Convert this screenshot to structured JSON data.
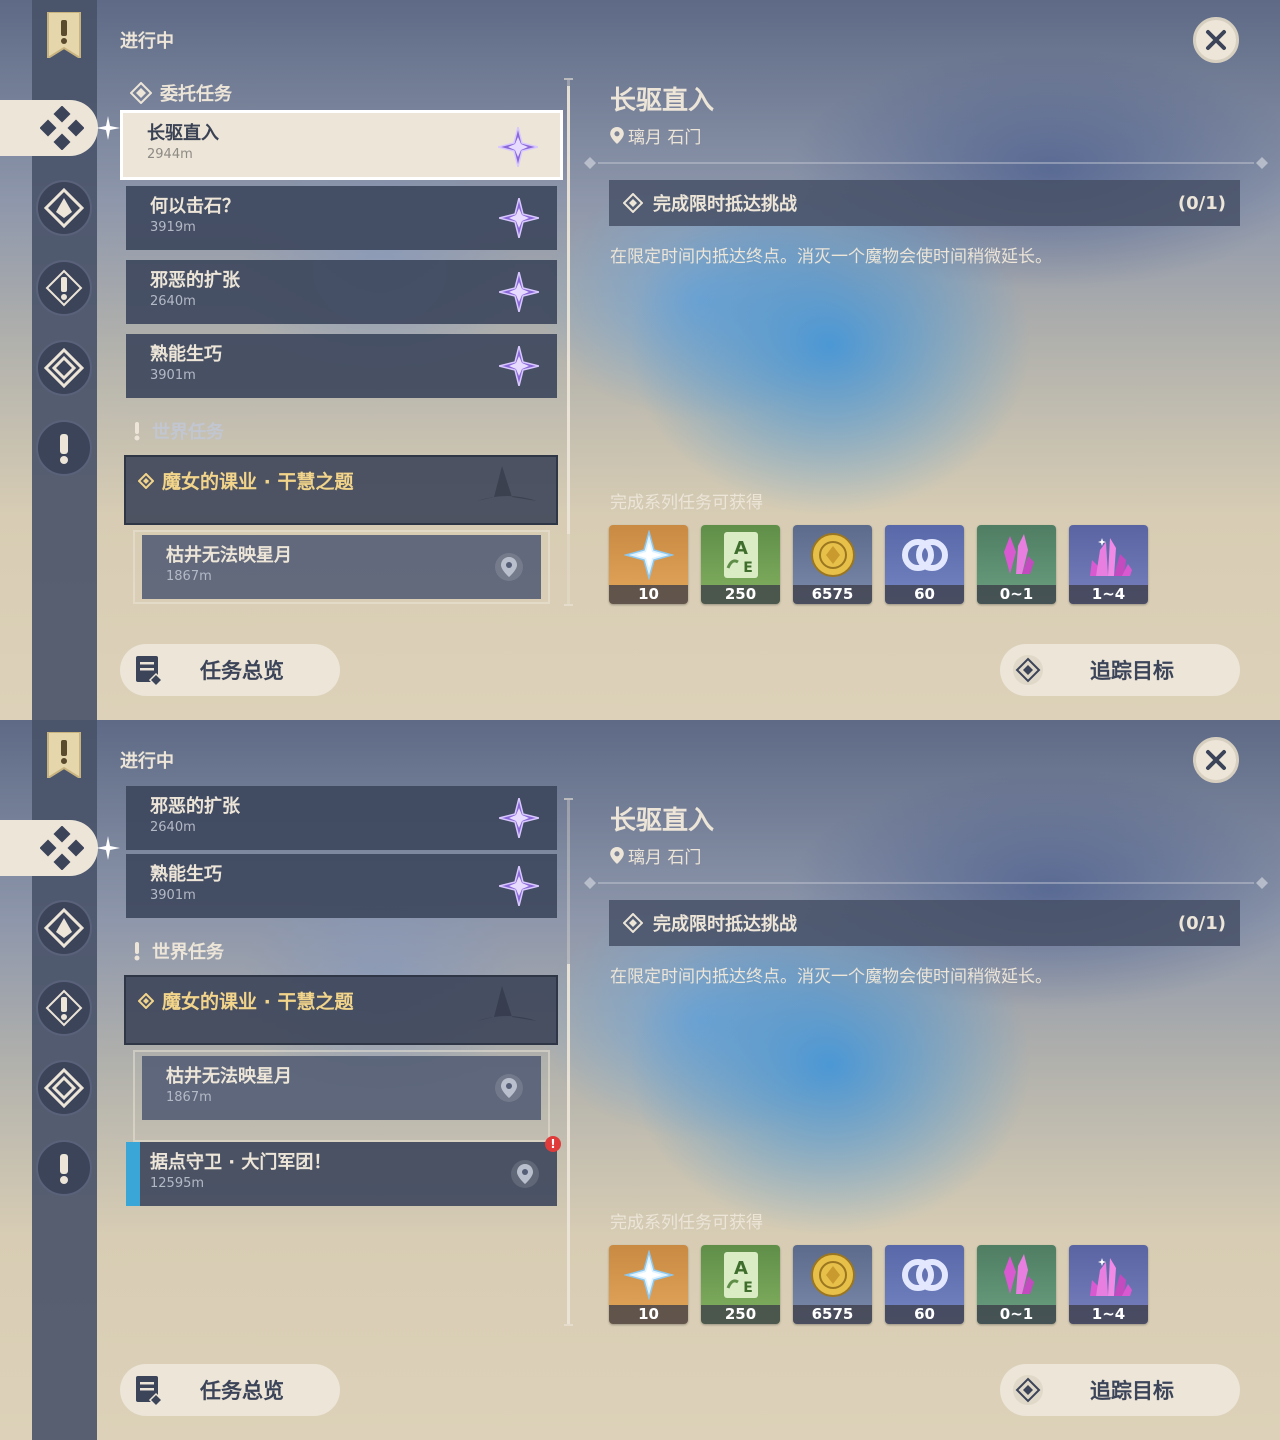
{
  "screens": [
    {
      "header": "进行中",
      "commission_section": "委托任务",
      "commissions": [
        {
          "name": "长驱直入",
          "distance": "2944m",
          "selected": true
        },
        {
          "name": "何以击石？",
          "distance": "3919m"
        },
        {
          "name": "邪恶的扩张",
          "distance": "2640m"
        },
        {
          "name": "熟能生巧",
          "distance": "3901m"
        }
      ],
      "world_section": "世界任务",
      "world_quest": {
        "title": "魔女的课业 · 干慧之题",
        "sub_name": "枯井无法映星月",
        "sub_distance": "1867m"
      }
    },
    {
      "header": "进行中",
      "commissions": [
        {
          "name": "邪恶的扩张",
          "distance": "2640m"
        },
        {
          "name": "熟能生巧",
          "distance": "3901m"
        }
      ],
      "world_section": "世界任务",
      "world_quest": {
        "title": "魔女的课业 · 干慧之题",
        "sub_name": "枯井无法映星月",
        "sub_distance": "1867m"
      },
      "extra_quest": {
        "name": "据点守卫 · 大门军团！",
        "distance": "12595m",
        "alert": "!"
      }
    }
  ],
  "detail": {
    "title": "长驱直入",
    "location": "璃月 石门",
    "objective": "完成限时抵达挑战",
    "progress": "(0/1)",
    "description": "在限定时间内抵达终点。消灭一个魔物会使时间稍微延长。",
    "rewards_title": "完成系列任务可获得",
    "rewards": [
      {
        "icon": "primogem-icon",
        "count": "10"
      },
      {
        "icon": "adventure-exp-icon",
        "count": "250"
      },
      {
        "icon": "mora-icon",
        "count": "6575"
      },
      {
        "icon": "friendship-exp-icon",
        "count": "60"
      },
      {
        "icon": "crystal-small-icon",
        "count": "0~1"
      },
      {
        "icon": "crystal-large-icon",
        "count": "1~4"
      }
    ]
  },
  "buttons": {
    "overview": "任务总览",
    "track": "追踪目标"
  },
  "colors": {
    "accent_cream": "#ece5d8",
    "panel_dark": "#3c4459",
    "world_gold": "#f2d48a",
    "alert_red": "#e03b3b",
    "track_blue": "#3aa6d8"
  }
}
